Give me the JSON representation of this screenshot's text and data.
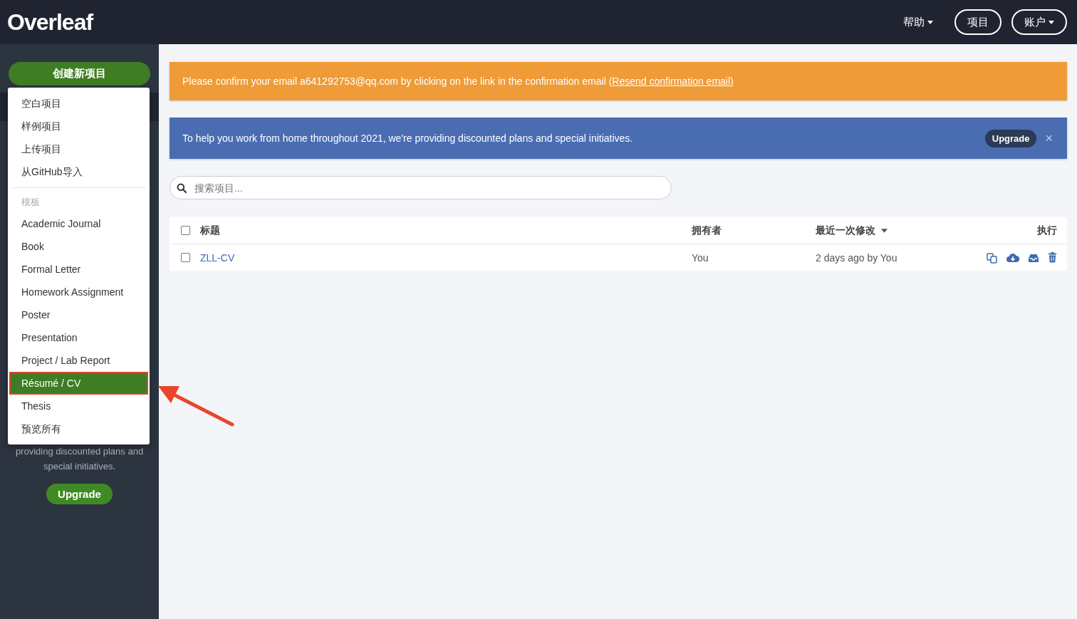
{
  "navbar": {
    "logo": "Overleaf",
    "links": [
      {
        "label": "帮助",
        "kind": "dropdown"
      },
      {
        "label": "项目",
        "kind": "pill"
      },
      {
        "label": "账户",
        "kind": "pill-dropdown"
      }
    ]
  },
  "sidebar": {
    "new_project_button": "创建新项目",
    "promo_lines": [
      "providing discounted plans and",
      "special initiatives."
    ],
    "upgrade_button": "Upgrade"
  },
  "new_project_menu": {
    "items": [
      {
        "kind": "item",
        "label": "空白项目",
        "selected": false
      },
      {
        "kind": "item",
        "label": "样例项目",
        "selected": false
      },
      {
        "kind": "item",
        "label": "上传项目",
        "selected": false
      },
      {
        "kind": "item",
        "label": "从GitHub导入",
        "selected": false
      },
      {
        "kind": "divider"
      },
      {
        "kind": "header",
        "label": "模板"
      },
      {
        "kind": "item",
        "label": "Academic Journal",
        "selected": false
      },
      {
        "kind": "item",
        "label": "Book",
        "selected": false
      },
      {
        "kind": "item",
        "label": "Formal Letter",
        "selected": false
      },
      {
        "kind": "item",
        "label": "Homework Assignment",
        "selected": false
      },
      {
        "kind": "item",
        "label": "Poster",
        "selected": false
      },
      {
        "kind": "item",
        "label": "Presentation",
        "selected": false
      },
      {
        "kind": "item",
        "label": "Project / Lab Report",
        "selected": false
      },
      {
        "kind": "item",
        "label": "Résumé / CV",
        "selected": true
      },
      {
        "kind": "item",
        "label": "Thesis",
        "selected": false
      },
      {
        "kind": "item",
        "label": "预览所有",
        "selected": false
      }
    ]
  },
  "email_alert": {
    "text": "Please confirm your email a641292753@qq.com by clicking on the link in the confirmation email",
    "link": "(Resend confirmation email)"
  },
  "promo_alert": {
    "text": "To help you work from home throughout 2021, we're providing discounted plans and special initiatives.",
    "button": "Upgrade",
    "close": "×"
  },
  "search": {
    "placeholder": "搜索项目..."
  },
  "table": {
    "columns": [
      {
        "label": "标题",
        "sorted": false
      },
      {
        "label": "拥有者",
        "sorted": false
      },
      {
        "label": "最近一次修改",
        "sorted": true
      },
      {
        "label": "执行",
        "sorted": false
      }
    ],
    "header_checked": false,
    "rows": [
      {
        "title": "ZLL-CV",
        "owner": "You",
        "modified": "2 days ago by You",
        "checked": false
      }
    ]
  }
}
